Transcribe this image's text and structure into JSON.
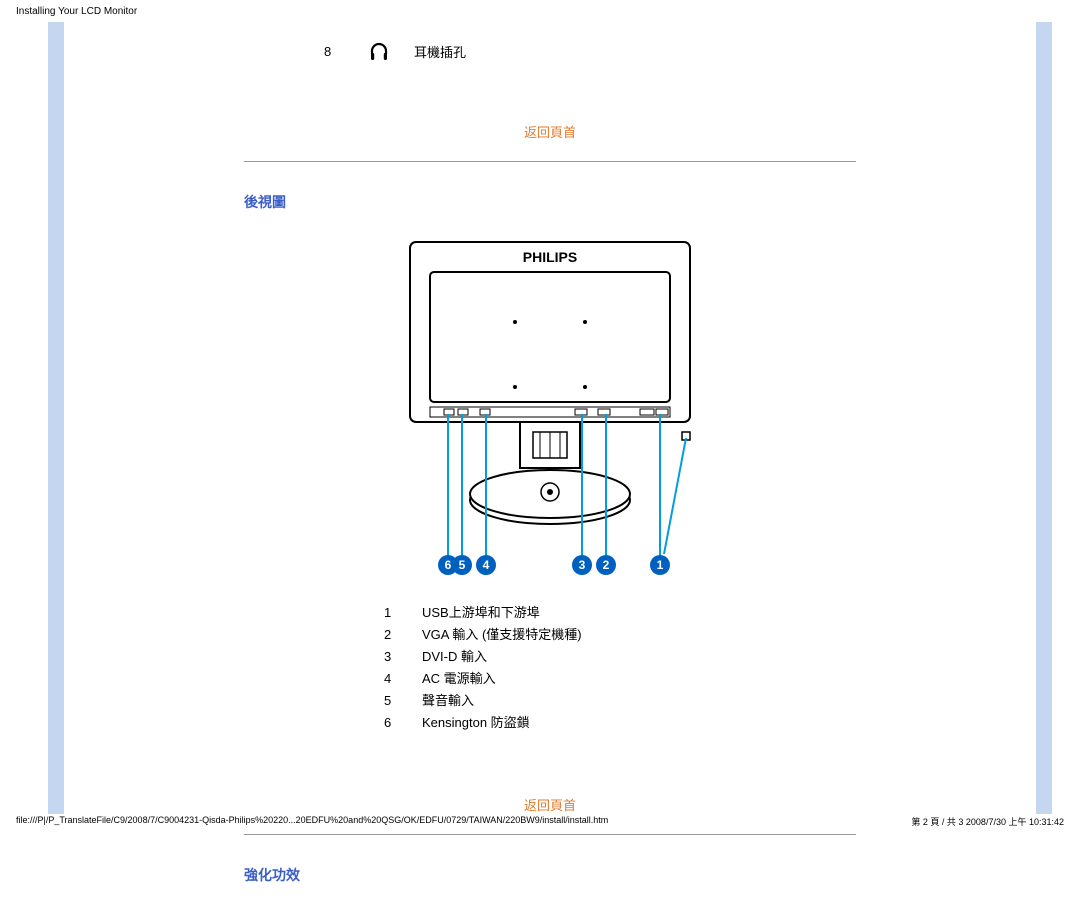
{
  "header": {
    "title": "Installing Your LCD Monitor"
  },
  "row8": {
    "num": "8",
    "label": "耳機插孔"
  },
  "back_top": "返回頁首",
  "section1": {
    "title": "後視圖"
  },
  "diagram": {
    "brand": "PHILIPS",
    "callouts": [
      "6",
      "5",
      "4",
      "3",
      "2",
      "1"
    ]
  },
  "ports": [
    {
      "n": "1",
      "label": "USB上游埠和下游埠"
    },
    {
      "n": "2",
      "label": "VGA 輸入 (僅支援特定機種)"
    },
    {
      "n": "3",
      "label": "DVI-D 輸入"
    },
    {
      "n": "4",
      "label": "AC 電源輸入"
    },
    {
      "n": "5",
      "label": "聲音輸入"
    },
    {
      "n": "6",
      "label": "Kensington 防盜鎖"
    }
  ],
  "section2": {
    "title": "強化功效"
  },
  "footer": {
    "path": "file:///P|/P_TranslateFile/C9/2008/7/C9004231-Qisda-Philips%20220...20EDFU%20and%20QSG/OK/EDFU/0729/TAIWAN/220BW9/install/install.htm",
    "pageinfo": "第 2 頁 / 共 3 2008/7/30 上午 10:31:42"
  }
}
